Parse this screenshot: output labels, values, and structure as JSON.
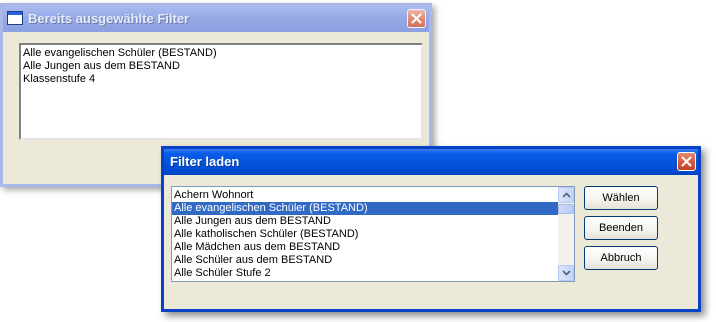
{
  "windows": {
    "selected_filters": {
      "title": "Bereits ausgewählte Filter",
      "items": [
        "Alle evangelischen Schüler (BESTAND)",
        "Alle Jungen aus dem BESTAND",
        "Klassenstufe 4"
      ]
    },
    "load_filter": {
      "title": "Filter laden",
      "items": [
        "Achern Wohnort",
        "Alle evangelischen Schüler (BESTAND)",
        "Alle Jungen aus dem BESTAND",
        "Alle katholischen Schüler  (BESTAND)",
        "Alle Mädchen aus dem BESTAND",
        "Alle Schüler aus dem BESTAND",
        "Alle Schüler Stufe 2"
      ],
      "selected_item": "Alle evangelischen Schüler (BESTAND)",
      "buttons": {
        "choose": "Wählen",
        "finish": "Beenden",
        "cancel": "Abbruch"
      }
    }
  },
  "colors": {
    "active_title": "#0455dd",
    "inactive_title": "#94a8e6",
    "selection": "#316ac5",
    "window_face": "#ece9d8"
  }
}
